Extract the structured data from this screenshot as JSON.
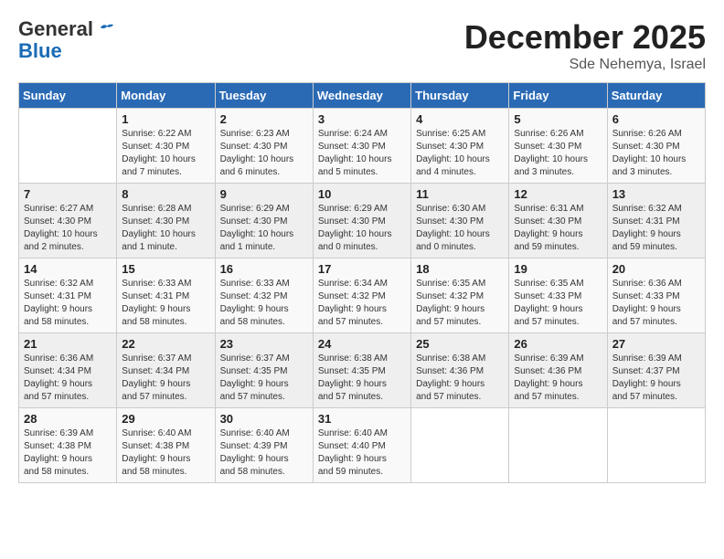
{
  "logo": {
    "general": "General",
    "blue": "Blue"
  },
  "title": "December 2025",
  "location": "Sde Nehemya, Israel",
  "days_of_week": [
    "Sunday",
    "Monday",
    "Tuesday",
    "Wednesday",
    "Thursday",
    "Friday",
    "Saturday"
  ],
  "weeks": [
    [
      {
        "day": "",
        "info": ""
      },
      {
        "day": "1",
        "info": "Sunrise: 6:22 AM\nSunset: 4:30 PM\nDaylight: 10 hours\nand 7 minutes."
      },
      {
        "day": "2",
        "info": "Sunrise: 6:23 AM\nSunset: 4:30 PM\nDaylight: 10 hours\nand 6 minutes."
      },
      {
        "day": "3",
        "info": "Sunrise: 6:24 AM\nSunset: 4:30 PM\nDaylight: 10 hours\nand 5 minutes."
      },
      {
        "day": "4",
        "info": "Sunrise: 6:25 AM\nSunset: 4:30 PM\nDaylight: 10 hours\nand 4 minutes."
      },
      {
        "day": "5",
        "info": "Sunrise: 6:26 AM\nSunset: 4:30 PM\nDaylight: 10 hours\nand 3 minutes."
      },
      {
        "day": "6",
        "info": "Sunrise: 6:26 AM\nSunset: 4:30 PM\nDaylight: 10 hours\nand 3 minutes."
      }
    ],
    [
      {
        "day": "7",
        "info": "Sunrise: 6:27 AM\nSunset: 4:30 PM\nDaylight: 10 hours\nand 2 minutes."
      },
      {
        "day": "8",
        "info": "Sunrise: 6:28 AM\nSunset: 4:30 PM\nDaylight: 10 hours\nand 1 minute."
      },
      {
        "day": "9",
        "info": "Sunrise: 6:29 AM\nSunset: 4:30 PM\nDaylight: 10 hours\nand 1 minute."
      },
      {
        "day": "10",
        "info": "Sunrise: 6:29 AM\nSunset: 4:30 PM\nDaylight: 10 hours\nand 0 minutes."
      },
      {
        "day": "11",
        "info": "Sunrise: 6:30 AM\nSunset: 4:30 PM\nDaylight: 10 hours\nand 0 minutes."
      },
      {
        "day": "12",
        "info": "Sunrise: 6:31 AM\nSunset: 4:30 PM\nDaylight: 9 hours\nand 59 minutes."
      },
      {
        "day": "13",
        "info": "Sunrise: 6:32 AM\nSunset: 4:31 PM\nDaylight: 9 hours\nand 59 minutes."
      }
    ],
    [
      {
        "day": "14",
        "info": "Sunrise: 6:32 AM\nSunset: 4:31 PM\nDaylight: 9 hours\nand 58 minutes."
      },
      {
        "day": "15",
        "info": "Sunrise: 6:33 AM\nSunset: 4:31 PM\nDaylight: 9 hours\nand 58 minutes."
      },
      {
        "day": "16",
        "info": "Sunrise: 6:33 AM\nSunset: 4:32 PM\nDaylight: 9 hours\nand 58 minutes."
      },
      {
        "day": "17",
        "info": "Sunrise: 6:34 AM\nSunset: 4:32 PM\nDaylight: 9 hours\nand 57 minutes."
      },
      {
        "day": "18",
        "info": "Sunrise: 6:35 AM\nSunset: 4:32 PM\nDaylight: 9 hours\nand 57 minutes."
      },
      {
        "day": "19",
        "info": "Sunrise: 6:35 AM\nSunset: 4:33 PM\nDaylight: 9 hours\nand 57 minutes."
      },
      {
        "day": "20",
        "info": "Sunrise: 6:36 AM\nSunset: 4:33 PM\nDaylight: 9 hours\nand 57 minutes."
      }
    ],
    [
      {
        "day": "21",
        "info": "Sunrise: 6:36 AM\nSunset: 4:34 PM\nDaylight: 9 hours\nand 57 minutes."
      },
      {
        "day": "22",
        "info": "Sunrise: 6:37 AM\nSunset: 4:34 PM\nDaylight: 9 hours\nand 57 minutes."
      },
      {
        "day": "23",
        "info": "Sunrise: 6:37 AM\nSunset: 4:35 PM\nDaylight: 9 hours\nand 57 minutes."
      },
      {
        "day": "24",
        "info": "Sunrise: 6:38 AM\nSunset: 4:35 PM\nDaylight: 9 hours\nand 57 minutes."
      },
      {
        "day": "25",
        "info": "Sunrise: 6:38 AM\nSunset: 4:36 PM\nDaylight: 9 hours\nand 57 minutes."
      },
      {
        "day": "26",
        "info": "Sunrise: 6:39 AM\nSunset: 4:36 PM\nDaylight: 9 hours\nand 57 minutes."
      },
      {
        "day": "27",
        "info": "Sunrise: 6:39 AM\nSunset: 4:37 PM\nDaylight: 9 hours\nand 57 minutes."
      }
    ],
    [
      {
        "day": "28",
        "info": "Sunrise: 6:39 AM\nSunset: 4:38 PM\nDaylight: 9 hours\nand 58 minutes."
      },
      {
        "day": "29",
        "info": "Sunrise: 6:40 AM\nSunset: 4:38 PM\nDaylight: 9 hours\nand 58 minutes."
      },
      {
        "day": "30",
        "info": "Sunrise: 6:40 AM\nSunset: 4:39 PM\nDaylight: 9 hours\nand 58 minutes."
      },
      {
        "day": "31",
        "info": "Sunrise: 6:40 AM\nSunset: 4:40 PM\nDaylight: 9 hours\nand 59 minutes."
      },
      {
        "day": "",
        "info": ""
      },
      {
        "day": "",
        "info": ""
      },
      {
        "day": "",
        "info": ""
      }
    ]
  ]
}
